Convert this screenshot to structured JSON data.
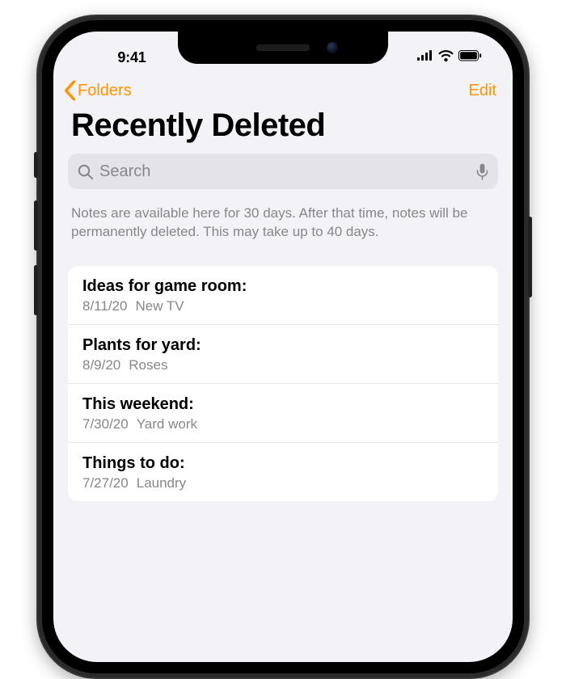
{
  "status": {
    "time": "9:41"
  },
  "nav": {
    "back_label": "Folders",
    "edit_label": "Edit"
  },
  "title": "Recently Deleted",
  "search": {
    "placeholder": "Search"
  },
  "info_text": "Notes are available here for 30 days. After that time, notes will be permanently deleted. This may take up to 40 days.",
  "notes": [
    {
      "title": "Ideas for game room:",
      "date": "8/11/20",
      "preview": "New TV"
    },
    {
      "title": "Plants for yard:",
      "date": "8/9/20",
      "preview": "Roses"
    },
    {
      "title": "This weekend:",
      "date": "7/30/20",
      "preview": "Yard work"
    },
    {
      "title": "Things to do:",
      "date": "7/27/20",
      "preview": "Laundry"
    }
  ]
}
